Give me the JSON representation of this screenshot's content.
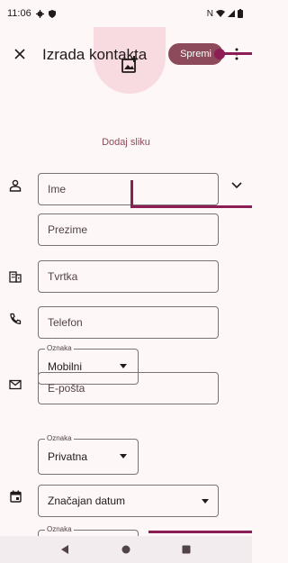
{
  "status": {
    "time": "11:06",
    "network": "N"
  },
  "app_bar": {
    "title": "Izrada kontakta",
    "save_label": "Spremi"
  },
  "photo": {
    "add_label": "Dodaj sliku"
  },
  "name": {
    "first_placeholder": "Ime",
    "last_placeholder": "Prezime"
  },
  "company": {
    "placeholder": "Tvrtka"
  },
  "phone": {
    "placeholder": "Telefon",
    "label_legend": "Oznaka",
    "label_value": "Mobilni"
  },
  "email": {
    "placeholder": "E-pošta",
    "label_legend": "Oznaka",
    "label_value": "Privatna"
  },
  "date": {
    "value": "Značajan datum",
    "label_legend": "Oznaka"
  },
  "colors": {
    "accent": "#8d4a5a",
    "annotation": "#8d1d55",
    "photo_bg": "#f8dbe1"
  }
}
